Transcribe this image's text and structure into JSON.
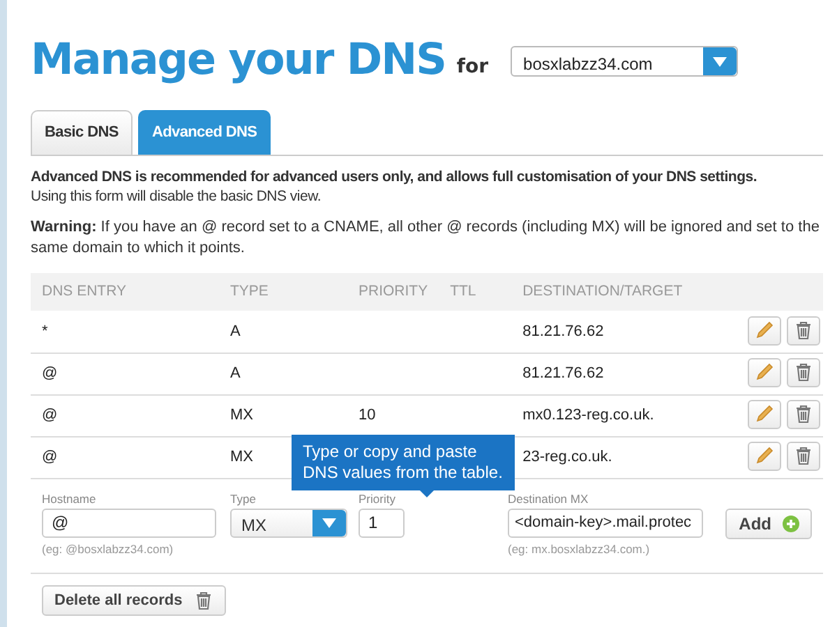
{
  "header": {
    "title": "Manage your DNS",
    "for_label": "for",
    "domain": "bosxlabzz34.com"
  },
  "tabs": [
    {
      "label": "Basic DNS",
      "selected": false
    },
    {
      "label": "Advanced DNS",
      "selected": true
    }
  ],
  "intro": {
    "lead": "Advanced DNS is recommended for advanced users only, and allows full customisation of your DNS settings.",
    "note": "Using this form will disable the basic DNS view."
  },
  "warning": "**Warning:** If you have an @ record set to a CNAME, all other @ records (including MX) will be ignored and set to the same domain to which it points.",
  "table": {
    "columns": [
      "DNS ENTRY",
      "TYPE",
      "PRIORITY",
      "TTL",
      "DESTINATION/TARGET"
    ],
    "rows": [
      [
        "*",
        "A",
        "",
        "",
        "81.21.76.62"
      ],
      [
        "@",
        "A",
        "",
        "",
        "81.21.76.62"
      ],
      [
        "@",
        "MX",
        "10",
        "",
        "mx0.123-reg.co.uk."
      ],
      [
        "@",
        "MX",
        "",
        "",
        "23-reg.co.uk."
      ]
    ]
  },
  "tooltip": "Type or copy and paste DNS values from the table.",
  "form": {
    "hostname": {
      "label": "Hostname",
      "value": "@",
      "hint": "(eg: @bosxlabzz34.com)"
    },
    "type": {
      "label": "Type",
      "value": "MX"
    },
    "priority": {
      "label": "Priority",
      "value": "1"
    },
    "destination": {
      "label": "Destination MX",
      "value": "<domain-key>.mail.protec",
      "hint": "(eg: mx.bosxlabzz34.com.)"
    },
    "add_button": "Add"
  },
  "delete_all_button": "Delete all records"
}
